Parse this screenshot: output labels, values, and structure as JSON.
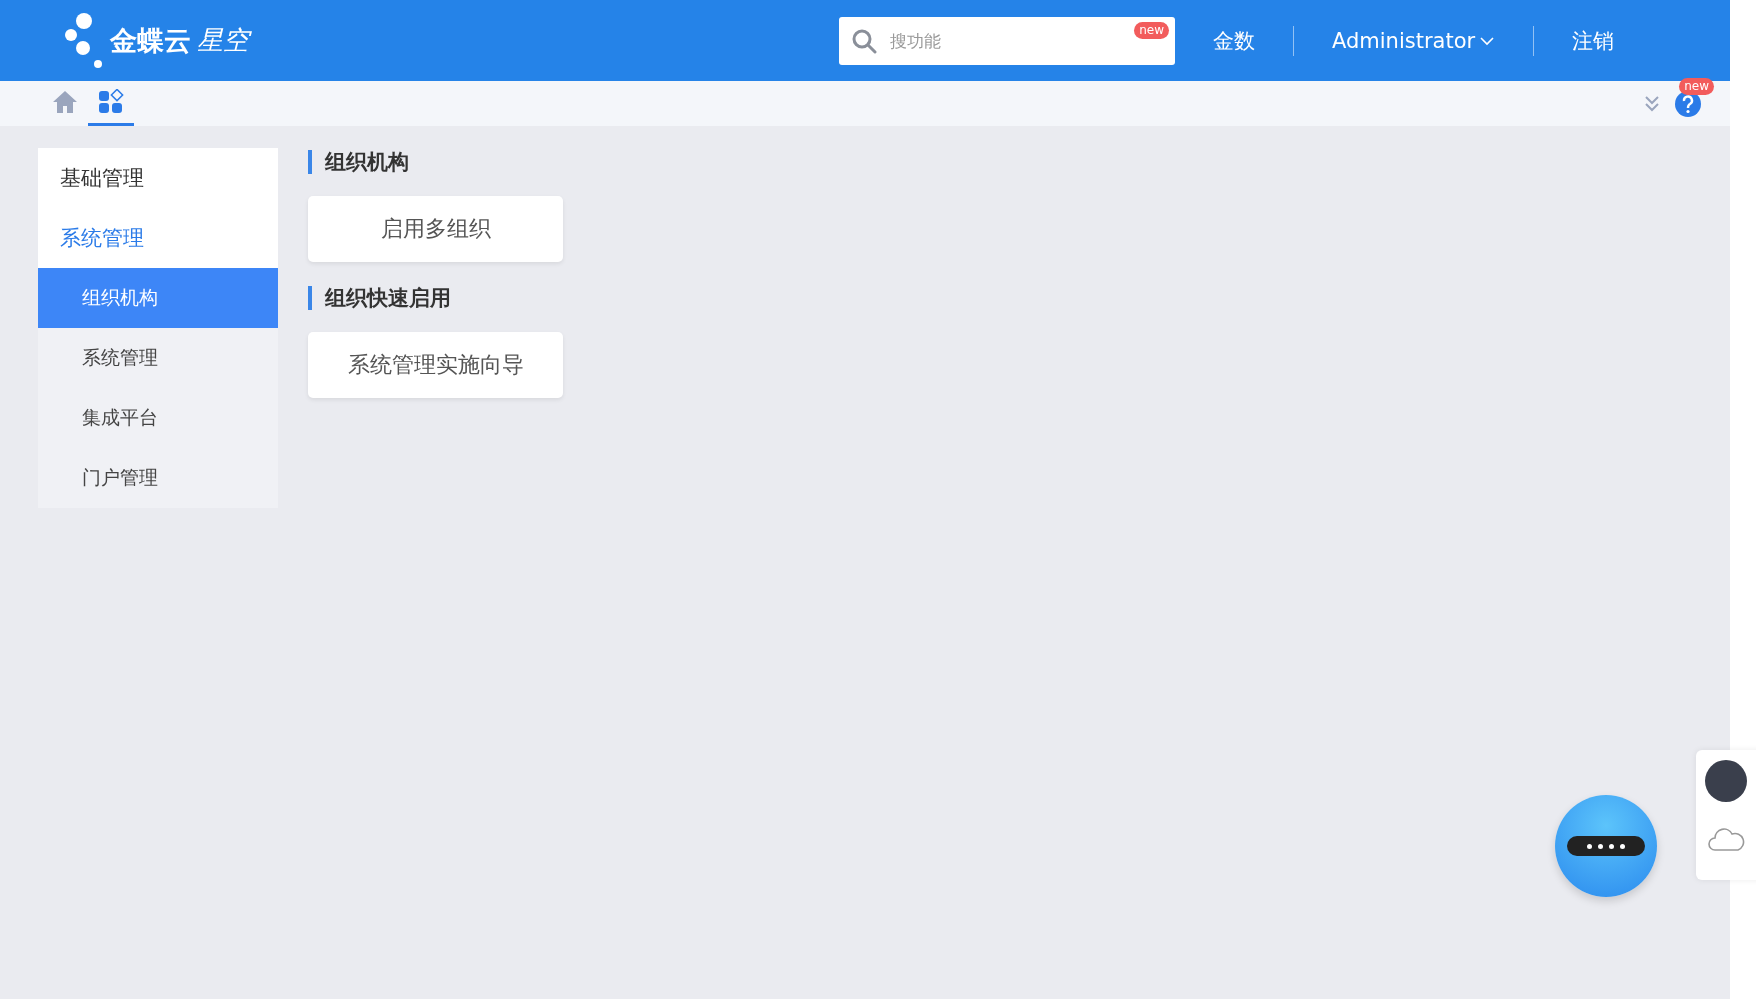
{
  "header": {
    "logo": "金蝶云",
    "logo_sub": "星空",
    "search": {
      "placeholder": "搜功能",
      "badge": "new"
    },
    "links": [
      "金数"
    ],
    "user": "Administrator",
    "logout": "注销"
  },
  "toolbar": {
    "tabs": [
      {
        "kind": "home",
        "selected": false
      },
      {
        "kind": "apps",
        "selected": true
      }
    ],
    "help_badge": "new"
  },
  "sidebar": {
    "groups": [
      {
        "label": "基础管理",
        "expanded": false
      },
      {
        "label": "系统管理",
        "expanded": true,
        "children": [
          {
            "label": "组织机构",
            "selected": true
          },
          {
            "label": "系统管理",
            "selected": false
          },
          {
            "label": "集成平台",
            "selected": false
          },
          {
            "label": "门户管理",
            "selected": false
          }
        ]
      }
    ]
  },
  "sections": [
    {
      "title": "组织机构",
      "buttons": [
        "启用多组织"
      ]
    },
    {
      "title": "组织快速启用",
      "buttons": [
        "系统管理实施向导"
      ]
    }
  ]
}
